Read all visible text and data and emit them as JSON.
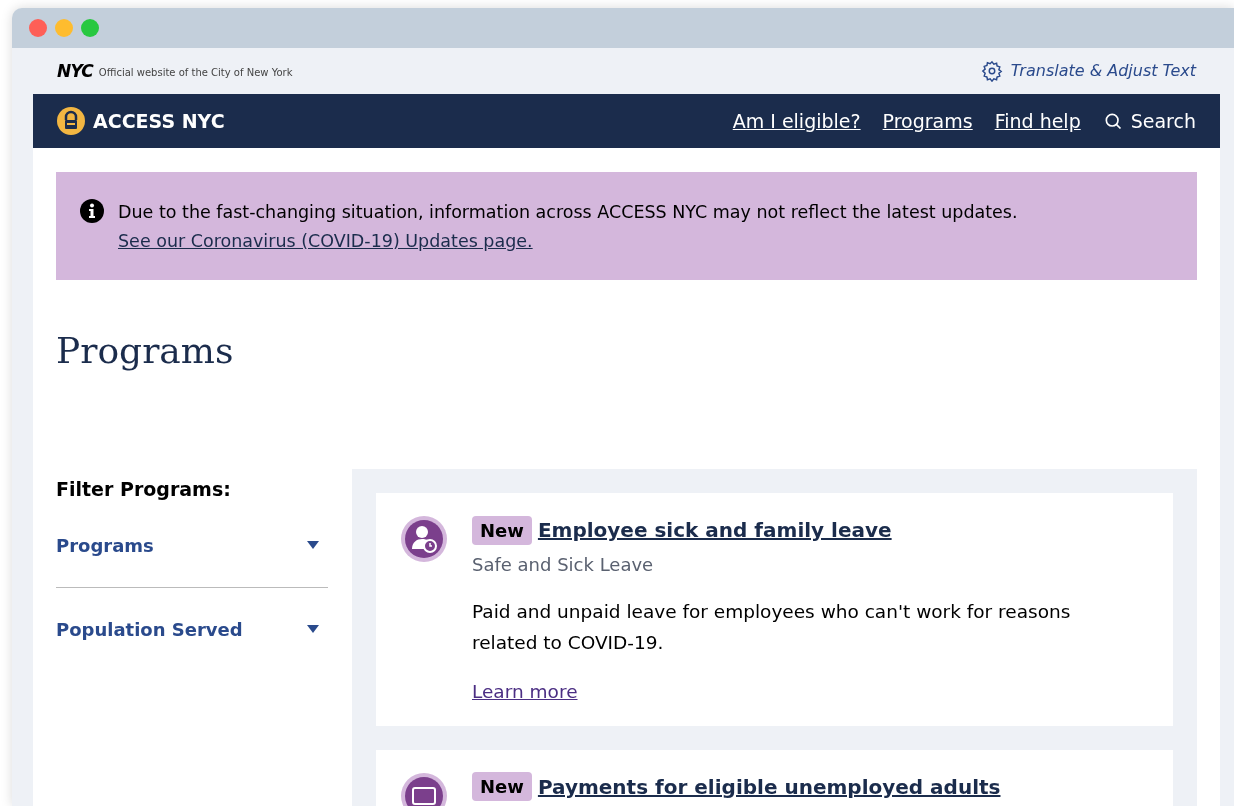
{
  "topbar": {
    "logo": "NYC",
    "tagline": "Official website of the City of New York",
    "translate": "Translate & Adjust Text"
  },
  "nav": {
    "brand": "ACCESS NYC",
    "links": [
      "Am I eligible?",
      "Programs",
      "Find help"
    ],
    "search": "Search"
  },
  "alert": {
    "message": "Due to the fast-changing situation, information across ACCESS NYC may not reflect the latest updates.",
    "link": "See our Coronavirus (COVID-19) Updates page."
  },
  "page_title": "Programs",
  "filters": {
    "title": "Filter Programs:",
    "items": [
      {
        "label": "Programs",
        "expanded": false
      },
      {
        "label": "Population Served",
        "expanded": false
      }
    ]
  },
  "programs": [
    {
      "badge": "New",
      "title": "Employee sick and family leave",
      "category": "Safe and Sick Leave",
      "description": "Paid and unpaid leave for employees who can't work for reasons related to COVID-19.",
      "link": "Learn more",
      "kind": "leave"
    },
    {
      "badge": "New",
      "title": "Payments for eligible unemployed adults",
      "kind": "payment"
    }
  ]
}
